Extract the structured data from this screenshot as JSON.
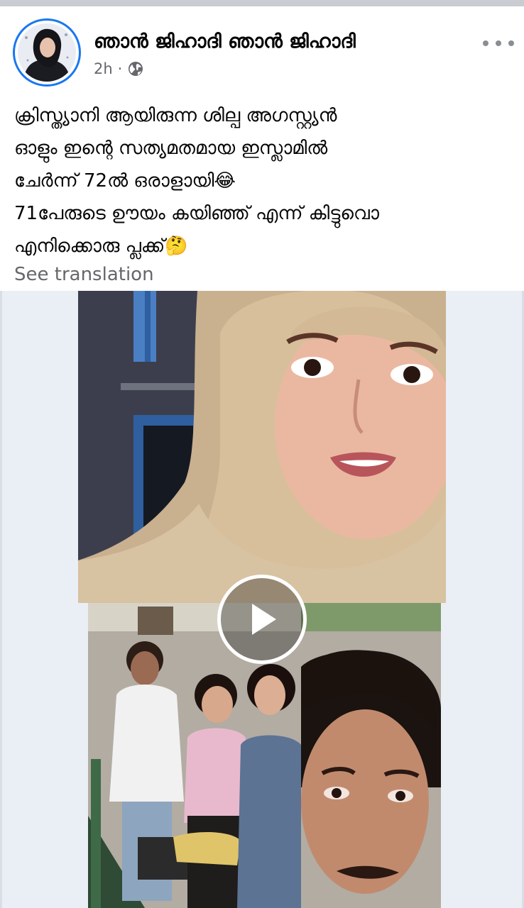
{
  "post": {
    "author_name": "ഞാൻ ജിഹാദി ഞാൻ ജിഹാദി",
    "time": "2h",
    "separator": "·",
    "privacy_icon": "globe-icon",
    "more_icon": "more-horizontal-icon",
    "text_lines": [
      "ക്രിസ്ത്യാനി ആയിരുന്ന ശില്പ അഗസ്റ്റ്യൻ",
      "ഓളും ഇന്റെ സത്യമതമായ ഇസ്ലാമിൽ",
      "ചേർന്ന് 72ൽ ഒരാളായി😂",
      "71പേരുടെ ഊയം കയിഞ്ഞ് എന്ന് കിട്ടുവൊ",
      "എനിക്കൊരു പ്ലക്ക്🤔"
    ],
    "see_translation": "See translation"
  },
  "media": {
    "play_icon": "play-icon"
  },
  "colors": {
    "accent": "#1877f2",
    "secondary_text": "#65676b",
    "divider": "#c9ccd1",
    "media_bg": "#eaeef5"
  }
}
